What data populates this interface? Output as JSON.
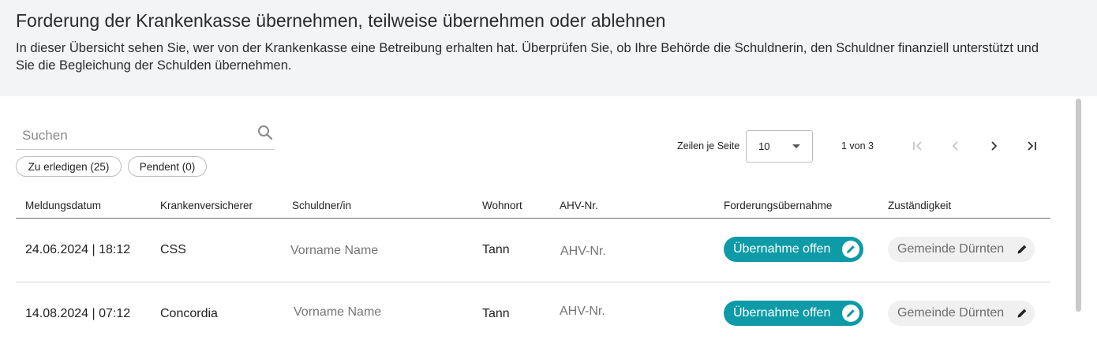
{
  "header": {
    "title": "Forderung der Krankenkasse übernehmen, teilweise übernehmen oder ablehnen",
    "description": "In dieser Übersicht sehen Sie, wer von der Krankenkasse eine Betreibung erhalten hat. Überprüfen Sie, ob Ihre Behörde die Schuldnerin, den Schuldner finanziell unterstützt und Sie die Begleichung der Schulden übernehmen."
  },
  "search": {
    "placeholder": "Suchen",
    "icon": "search-icon"
  },
  "filters": [
    {
      "label": "Zu erledigen (25)"
    },
    {
      "label": "Pendent (0)"
    }
  ],
  "pagination": {
    "rows_label": "Zeilen je Seite",
    "rows_value": "10",
    "page_info": "1 von 3"
  },
  "table": {
    "columns": [
      "Meldungsdatum",
      "Krankenversicherer",
      "Schuldner/in",
      "Wohnort",
      "AHV-Nr.",
      "Forderungsübernahme",
      "Zuständigkeit"
    ],
    "rows": [
      {
        "date": "24.06.2024 | 18:12",
        "insurer": "CSS",
        "debtor": "Vorname Name",
        "residence": "Tann",
        "ahv": "AHV-Nr.",
        "status": "Übernahme offen",
        "responsibility": "Gemeinde Dürnten"
      },
      {
        "date": "14.08.2024 | 07:12",
        "insurer": "Concordia",
        "debtor": "Vorname Name",
        "residence": "Tann",
        "ahv": "AHV-Nr.",
        "status": "Übernahme offen",
        "responsibility": "Gemeinde Dürnten"
      }
    ]
  },
  "colors": {
    "accent": "#0e9aa7",
    "pill_gray": "#f0f0f0",
    "background": "#f3f4f6"
  }
}
